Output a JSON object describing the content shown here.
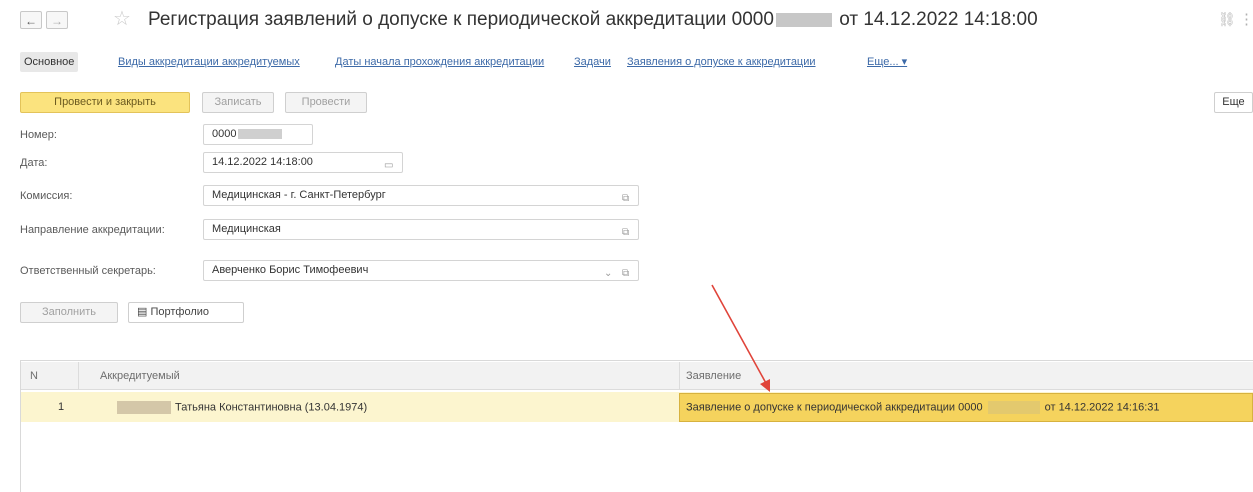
{
  "window": {
    "back_glyph": "←",
    "forward_glyph": "→",
    "favorite_icon": "star-icon",
    "title_prefix": "Регистрация заявлений о допуске к периодической аккредитации 0000",
    "title_suffix": "от 14.12.2022 14:18:00",
    "link_icon": "link-icon",
    "more_icon": "vertical-dots-icon"
  },
  "tabs": {
    "main": "Основное",
    "links": [
      "Виды аккредитации аккредитуемых",
      "Даты начала прохождения аккредитации",
      "Задачи",
      "Заявления о допуске к аккредитации",
      "Еще... ▾"
    ]
  },
  "toolbar": {
    "post_close": "Провести и закрыть",
    "save": "Записать",
    "post": "Провести",
    "more": "Еще"
  },
  "form": {
    "number_label": "Номер:",
    "number_value": "0000",
    "date_label": "Дата:",
    "date_value": "14.12.2022 14:18:00",
    "commission_label": "Комиссия:",
    "commission_value": "Медицинская - г. Санкт-Петербург",
    "direction_label": "Направление аккредитации:",
    "direction_value": "Медицинская",
    "secretary_label": "Ответственный секретарь:",
    "secretary_value": "Аверченко Борис Тимофеевич"
  },
  "table_toolbar": {
    "fill": "Заполнить",
    "portfolio": "Портфолио"
  },
  "table": {
    "headers": [
      "N",
      "Аккредитуемый",
      "Заявление"
    ],
    "rows": [
      {
        "n": "1",
        "accredited": "Татьяна Константиновна (13.04.1974)",
        "application_prefix": "Заявление о допуске к периодической аккредитации 0000",
        "application_suffix": "от 14.12.2022 14:16:31"
      }
    ]
  },
  "colors": {
    "primary_button": "#fbe37e",
    "selected_row": "#fcf5cf",
    "selected_cell": "#f5d35d",
    "link": "#3d6aa8",
    "arrow": "#e0443a"
  }
}
